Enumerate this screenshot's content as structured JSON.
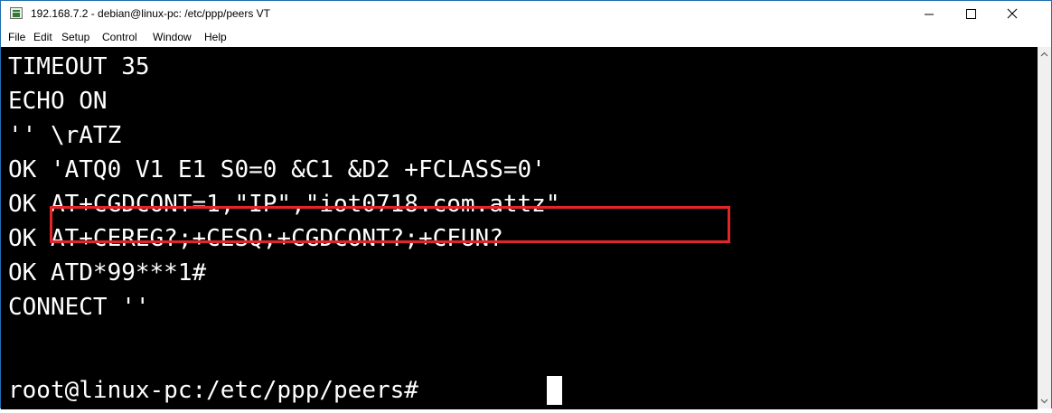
{
  "window": {
    "title": "192.168.7.2 - debian@linux-pc: /etc/ppp/peers VT",
    "controls": {
      "minimize_icon": "minimize-icon",
      "maximize_icon": "maximize-icon",
      "close_icon": "close-icon"
    }
  },
  "menu": {
    "items": [
      "File",
      "Edit",
      "Setup",
      "Control",
      "Window",
      "Help"
    ]
  },
  "terminal": {
    "lines": [
      "TIMEOUT 35",
      "ECHO ON",
      "'' \\rATZ",
      "OK 'ATQ0 V1 E1 S0=0 &C1 &D2 +FCLASS=0'",
      "OK AT+CGDCONT=1,\"IP\",\"iot0718.com.attz\"",
      "OK AT+CEREG?;+CESQ;+CGDCONT?;+CFUN?",
      "OK ATD*99***1#",
      "CONNECT ''",
      "root@linux-pc:/etc/ppp/peers# "
    ],
    "highlighted_text": "AT+CGDCONT=1,\"IP\",\"iot0718.com.attz\"",
    "highlight_color": "#e0262b",
    "background_color": "#000000",
    "text_color": "#ffffff"
  },
  "scrollbar": {
    "up_icon": "scroll-up-arrow-icon",
    "down_icon": "scroll-down-arrow-icon"
  }
}
